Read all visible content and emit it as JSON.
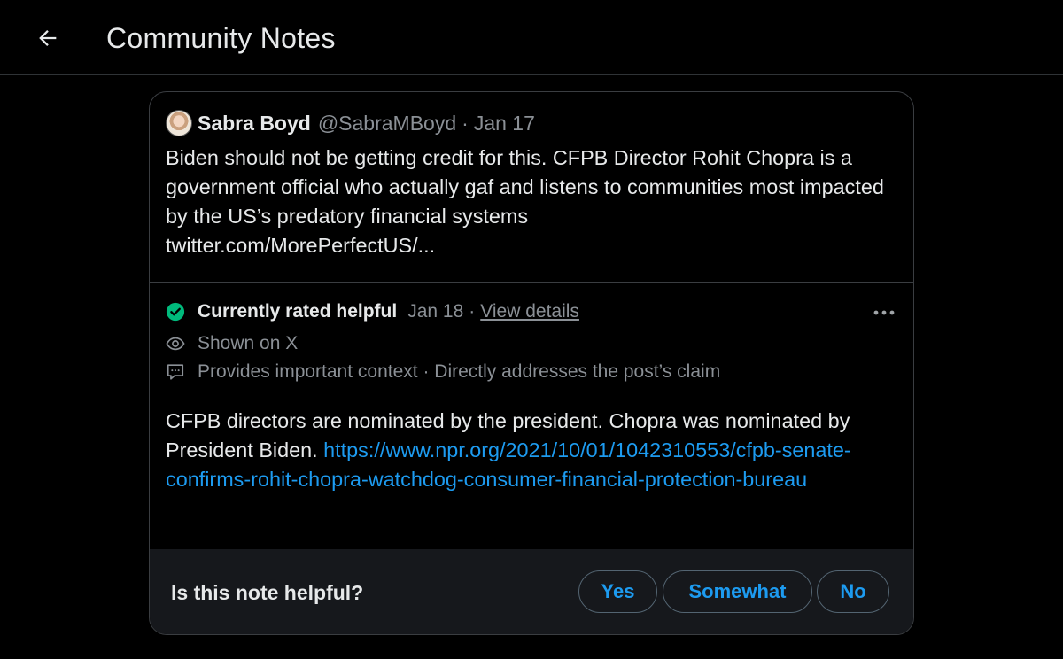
{
  "header": {
    "title": "Community Notes",
    "back_icon": "arrow-left-icon"
  },
  "post": {
    "author_name": "Sabra Boyd",
    "author_handle": "@SabraMBoyd",
    "separator": "·",
    "date": "Jan 17",
    "text": "Biden should not be getting credit for this. CFPB Director Rohit Chopra is a government official who actually gaf and listens to communities most impacted by the US’s predatory financial systems",
    "link": "twitter.com/MorePerfectUS/..."
  },
  "note": {
    "status_label": "Currently rated helpful",
    "status_date": "Jan 18",
    "separator": "·",
    "view_details": "View details",
    "shown_on": "Shown on X",
    "context": "Provides important context · Directly addresses the post’s claim",
    "body_text": "CFPB directors are nominated by the president. Chopra was nominated by President Biden. ",
    "body_link": "https://www.npr.org/2021/10/01/1042310553/cfpb-senate-confirms-rohit-chopra-watchdog-consumer-financial-protection-bureau",
    "status_color": "#00ba7c",
    "link_color": "#1d9bf0"
  },
  "feedback": {
    "question": "Is this note helpful?",
    "yes": "Yes",
    "somewhat": "Somewhat",
    "no": "No"
  }
}
